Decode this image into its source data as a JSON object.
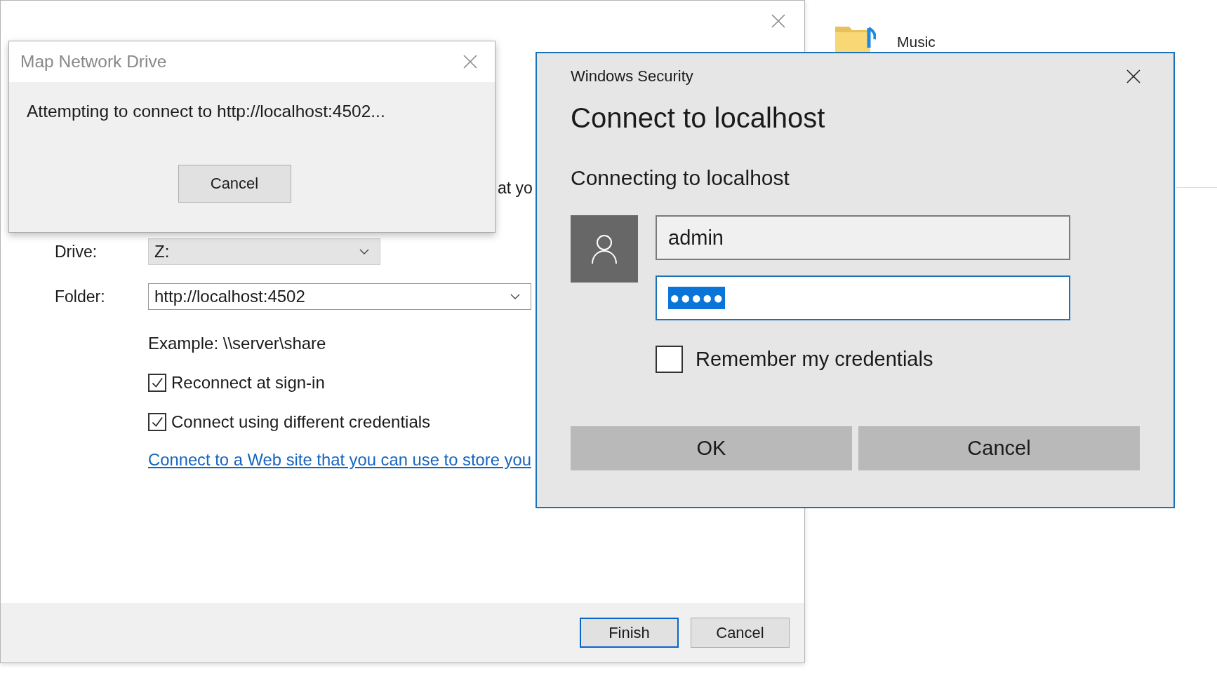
{
  "background_window": {
    "description_fragment": "at yo",
    "fields": [
      {
        "label": "Drive:",
        "value": "Z:",
        "disabled": true
      },
      {
        "label": "Folder:",
        "value": "http://localhost:4502",
        "disabled": false
      }
    ],
    "example": "Example: \\\\server\\share",
    "checkboxes": [
      {
        "label": "Reconnect at sign-in",
        "checked": true
      },
      {
        "label": "Connect using different credentials",
        "checked": true
      }
    ],
    "link": "Connect to a Web site that you can use to store you",
    "buttons": [
      {
        "label": "Finish",
        "default": true
      },
      {
        "label": "Cancel",
        "default": false
      }
    ]
  },
  "desktop": {
    "items": [
      {
        "label": "Music"
      }
    ]
  },
  "progress_dialog": {
    "title": "Map Network Drive",
    "message": "Attempting to connect to http://localhost:4502...",
    "button": "Cancel"
  },
  "security_dialog": {
    "header": "Windows Security",
    "title": "Connect to localhost",
    "subtitle": "Connecting to localhost",
    "username": "admin",
    "password": "●●●●●",
    "password_selected": true,
    "remember": {
      "label": "Remember my credentials",
      "checked": false
    },
    "buttons": [
      "OK",
      "Cancel"
    ]
  }
}
